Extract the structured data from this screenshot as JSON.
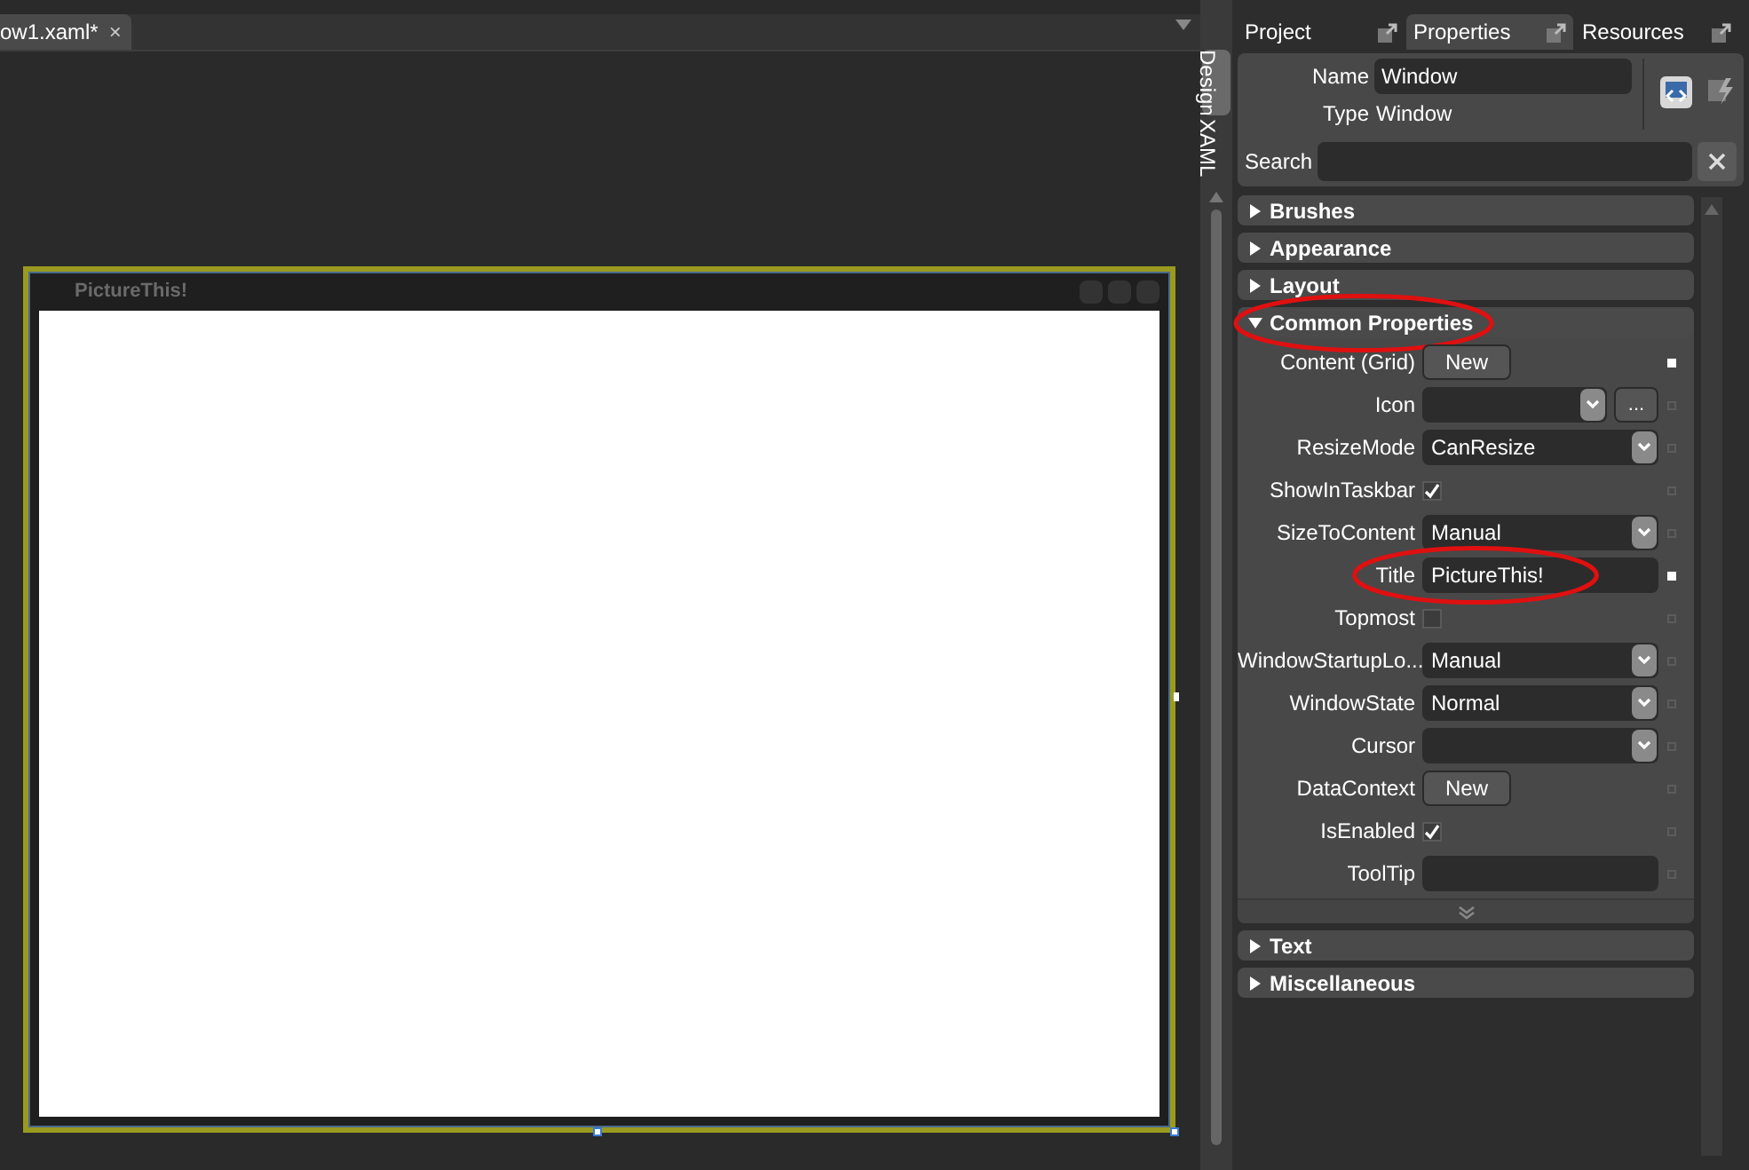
{
  "document_tabs": [
    {
      "label": "ow1.xaml*",
      "close": "×",
      "selected": true
    }
  ],
  "view_tabs": [
    {
      "label": "Design",
      "selected": true
    },
    {
      "label": "XAML",
      "selected": false
    }
  ],
  "artboard": {
    "window_title": "PictureThis!",
    "selected": true
  },
  "panel_tabs": [
    {
      "label": "Project",
      "selected": false
    },
    {
      "label": "Properties",
      "selected": true
    },
    {
      "label": "Resources",
      "selected": false
    }
  ],
  "element": {
    "name_label": "Name",
    "name_value": "Window",
    "type_label": "Type",
    "type_value": "Window"
  },
  "search": {
    "label": "Search"
  },
  "categories": [
    {
      "label": "Brushes",
      "expanded": false,
      "highlighted": false
    },
    {
      "label": "Appearance",
      "expanded": false,
      "highlighted": false
    },
    {
      "label": "Layout",
      "expanded": false,
      "highlighted": false
    },
    {
      "label": "Common Properties",
      "expanded": true,
      "highlighted": true,
      "properties": [
        {
          "kind": "button",
          "label": "Content (Grid)",
          "button": "New",
          "set": true,
          "highlighted": false
        },
        {
          "kind": "combo-ellipsis",
          "label": "Icon",
          "button": "...",
          "set": false,
          "highlighted": false
        },
        {
          "kind": "combo",
          "label": "ResizeMode",
          "value": "CanResize",
          "set": false,
          "highlighted": false
        },
        {
          "kind": "checkbox",
          "label": "ShowInTaskbar",
          "checked": true,
          "set": false,
          "highlighted": false
        },
        {
          "kind": "combo",
          "label": "SizeToContent",
          "value": "Manual",
          "set": false,
          "highlighted": false
        },
        {
          "kind": "text",
          "label": "Title",
          "value": "PictureThis!",
          "set": true,
          "highlighted": true
        },
        {
          "kind": "checkbox",
          "label": "Topmost",
          "checked": false,
          "set": false,
          "highlighted": false
        },
        {
          "kind": "combo",
          "label": "WindowStartupLo...",
          "value": "Manual",
          "set": false,
          "highlighted": false
        },
        {
          "kind": "combo",
          "label": "WindowState",
          "value": "Normal",
          "set": false,
          "highlighted": false
        },
        {
          "kind": "combo",
          "label": "Cursor",
          "set": false,
          "highlighted": false
        },
        {
          "kind": "button",
          "label": "DataContext",
          "button": "New",
          "set": false,
          "highlighted": false
        },
        {
          "kind": "checkbox",
          "label": "IsEnabled",
          "checked": true,
          "set": false,
          "highlighted": false
        },
        {
          "kind": "text",
          "label": "ToolTip",
          "set": false,
          "highlighted": false
        }
      ]
    },
    {
      "label": "Text",
      "expanded": false,
      "highlighted": false
    },
    {
      "label": "Miscellaneous",
      "expanded": false,
      "highlighted": false
    }
  ]
}
